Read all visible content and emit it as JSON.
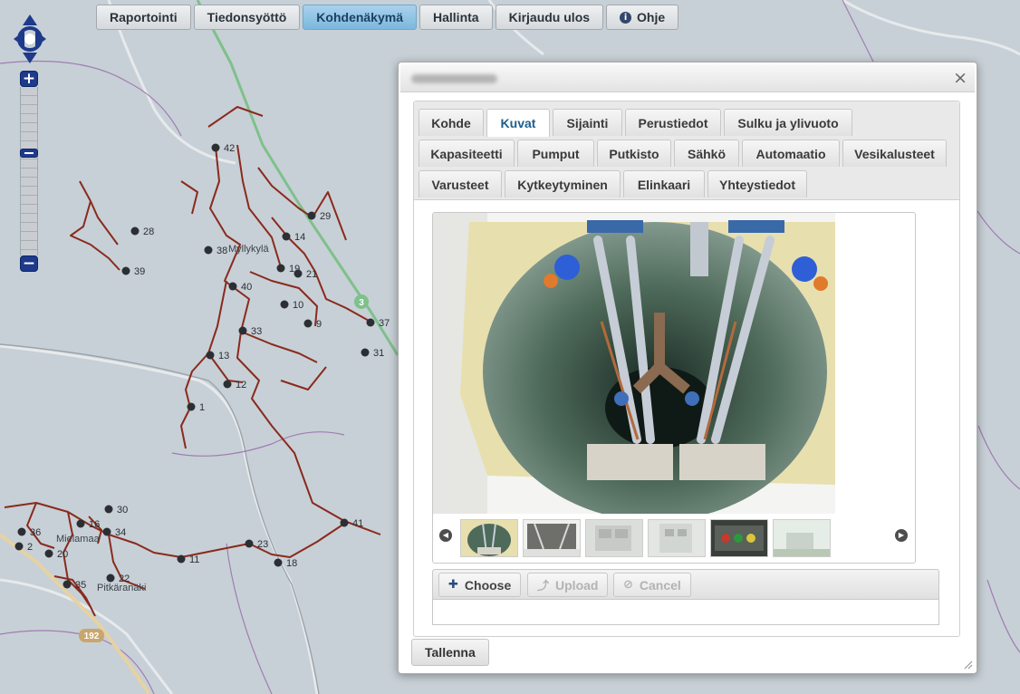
{
  "nav": [
    {
      "label": "Raportointi",
      "active": false
    },
    {
      "label": "Tiedonsyöttö",
      "active": false
    },
    {
      "label": "Kohdenäkymä",
      "active": true
    },
    {
      "label": "Hallinta",
      "active": false
    },
    {
      "label": "Kirjaudu ulos",
      "active": false
    },
    {
      "label": "Ohje",
      "active": false
    }
  ],
  "map": {
    "points": [
      {
        "id": "42",
        "label": "42"
      },
      {
        "id": "28",
        "label": "28"
      },
      {
        "id": "39",
        "label": "39"
      },
      {
        "id": "38",
        "label": "38"
      },
      {
        "id": "14",
        "label": "14"
      },
      {
        "id": "29",
        "label": "29"
      },
      {
        "id": "19",
        "label": "19"
      },
      {
        "id": "21",
        "label": "21"
      },
      {
        "id": "40",
        "label": "40"
      },
      {
        "id": "10",
        "label": "10"
      },
      {
        "id": "9",
        "label": "9"
      },
      {
        "id": "37",
        "label": "37"
      },
      {
        "id": "31",
        "label": "31"
      },
      {
        "id": "33",
        "label": "33"
      },
      {
        "id": "13",
        "label": "13"
      },
      {
        "id": "12",
        "label": "12"
      },
      {
        "id": "1",
        "label": "1"
      },
      {
        "id": "30",
        "label": "30"
      },
      {
        "id": "16",
        "label": "16"
      },
      {
        "id": "34",
        "label": "34"
      },
      {
        "id": "36",
        "label": "36"
      },
      {
        "id": "2",
        "label": "2"
      },
      {
        "id": "20",
        "label": "20"
      },
      {
        "id": "35",
        "label": "35"
      },
      {
        "id": "22",
        "label": "22"
      },
      {
        "id": "11",
        "label": "11"
      },
      {
        "id": "23",
        "label": "23"
      },
      {
        "id": "18",
        "label": "18"
      },
      {
        "id": "41",
        "label": "41"
      }
    ],
    "place_labels": {
      "village_top": "Myllykylä",
      "village_bottom_left": "Mielamaa",
      "village_bottom": "Pitkäranäki"
    },
    "road_badges": {
      "r192": "192",
      "r3": "3"
    }
  },
  "dialog": {
    "close_symbol": "×",
    "tabs": [
      {
        "label": "Kohde",
        "active": false
      },
      {
        "label": "Kuvat",
        "active": true
      },
      {
        "label": "Sijainti",
        "active": false
      },
      {
        "label": "Perustiedot",
        "active": false
      },
      {
        "label": "Sulku ja ylivuoto",
        "active": false
      },
      {
        "label": "Kapasiteetti",
        "active": false
      },
      {
        "label": "Pumput",
        "active": false
      },
      {
        "label": "Putkisto",
        "active": false
      },
      {
        "label": "Sähkö",
        "active": false
      },
      {
        "label": "Automaatio",
        "active": false
      },
      {
        "label": "Vesikalusteet",
        "active": false
      },
      {
        "label": "Varusteet",
        "active": false
      },
      {
        "label": "Kytkeytyminen",
        "active": false
      },
      {
        "label": "Elinkaari",
        "active": false
      },
      {
        "label": "Yhteystiedot",
        "active": false
      }
    ],
    "gallery": {
      "prev_symbol": "◀",
      "next_symbol": "▶"
    },
    "upload": {
      "choose": "Choose",
      "upload": "Upload",
      "cancel": "Cancel"
    },
    "save": "Tallenna"
  }
}
